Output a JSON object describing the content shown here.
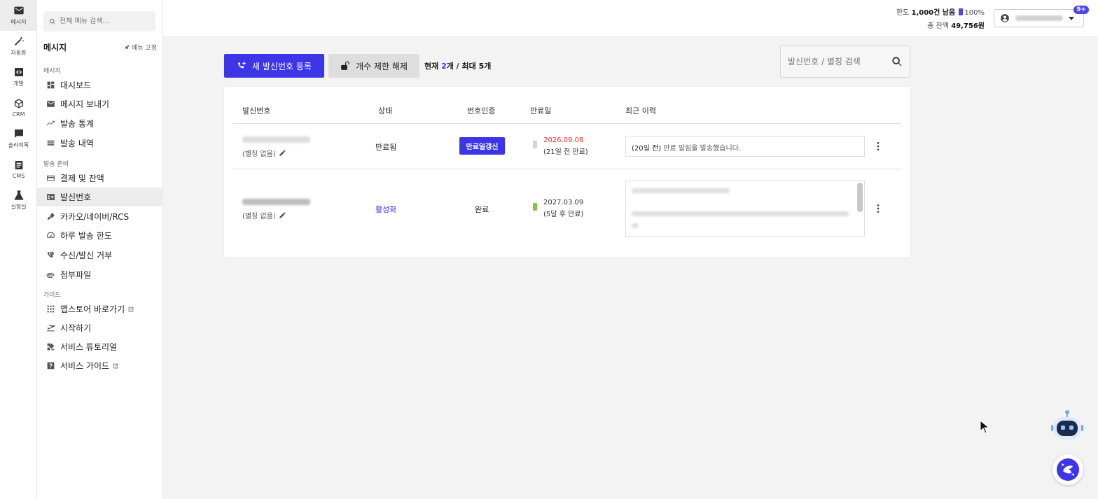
{
  "rail": [
    {
      "icon": "mail-icon",
      "label": "메시지",
      "active": true
    },
    {
      "icon": "magic-wand-icon",
      "label": "자동화"
    },
    {
      "icon": "code-icon",
      "label": "개발"
    },
    {
      "icon": "cube-icon",
      "label": "CRM"
    },
    {
      "icon": "chat-icon",
      "label": "솔라피톡"
    },
    {
      "icon": "document-icon",
      "label": "CMS"
    },
    {
      "icon": "flask-icon",
      "label": "실험실"
    }
  ],
  "sidebar": {
    "search_placeholder": "전체 메뉴 검색...",
    "title": "메시지",
    "pin_label": "메뉴 고정",
    "sections": {
      "message": "메시지",
      "prepare": "발송 준비",
      "guide": "가이드"
    },
    "items": [
      {
        "icon": "dashboard-icon",
        "label": "대시보드"
      },
      {
        "icon": "mail-icon",
        "label": "메시지 보내기"
      },
      {
        "icon": "trend-icon",
        "label": "발송 통계"
      },
      {
        "icon": "list-icon",
        "label": "발송 내역"
      },
      {
        "icon": "card-icon",
        "label": "결제 및 잔액"
      },
      {
        "icon": "id-card-icon",
        "label": "발신번호",
        "active": true
      },
      {
        "icon": "rocket-icon",
        "label": "카카오/네이버/RCS"
      },
      {
        "icon": "speedometer-icon",
        "label": "하루 발송 한도"
      },
      {
        "icon": "block-phone-icon",
        "label": "수신/발신 거부"
      },
      {
        "icon": "paperclip-icon",
        "label": "첨부파일"
      },
      {
        "icon": "grid-icon",
        "label": "앱스토어 바로가기"
      },
      {
        "icon": "takeoff-icon",
        "label": "시작하기"
      },
      {
        "icon": "tutorial-icon",
        "label": "서비스 튜토리얼"
      },
      {
        "icon": "help-icon",
        "label": "서비스 가이드"
      }
    ]
  },
  "topbar": {
    "quota_label": "한도",
    "quota_value": "1,000건 남음",
    "quota_percent": "100%",
    "balance_label": "총 잔액",
    "balance_value": "49,756원",
    "notification_badge": "9+"
  },
  "actions": {
    "new_number": "새 발신번호 등록",
    "unlock_limit": "개수 제한 해제",
    "count_prefix": "현재 ",
    "count_current": "2",
    "count_mid": "개 / 최대 ",
    "count_max": "5",
    "count_suffix": "개",
    "search_placeholder": "발신번호 / 별칭 검색"
  },
  "table": {
    "headers": [
      "발신번호",
      "상태",
      "번호인증",
      "만료일",
      "최근 이력"
    ],
    "rows": [
      {
        "alias": "(별칭 없음)",
        "status": "만료됨",
        "verify": "만료일갱신",
        "expire_date": "2026.09.08",
        "expire_note": "(21일 전 만료)",
        "expire_color": "#e53935",
        "battery_color": "#cfd4d8",
        "history_prefix": "(20일 전)",
        "history_text": " 만료 알림을 발송했습니다."
      },
      {
        "alias": "(별칭 없음)",
        "status": "활성화",
        "verify": "완료",
        "expire_date": "2027.03.09",
        "expire_note": "(5달 후 만료)",
        "expire_color": "#333333",
        "battery_color": "#8bc34a"
      }
    ]
  },
  "colors": {
    "accent": "#3d35e8",
    "expired": "#e53935",
    "active_battery": "#8bc34a"
  }
}
